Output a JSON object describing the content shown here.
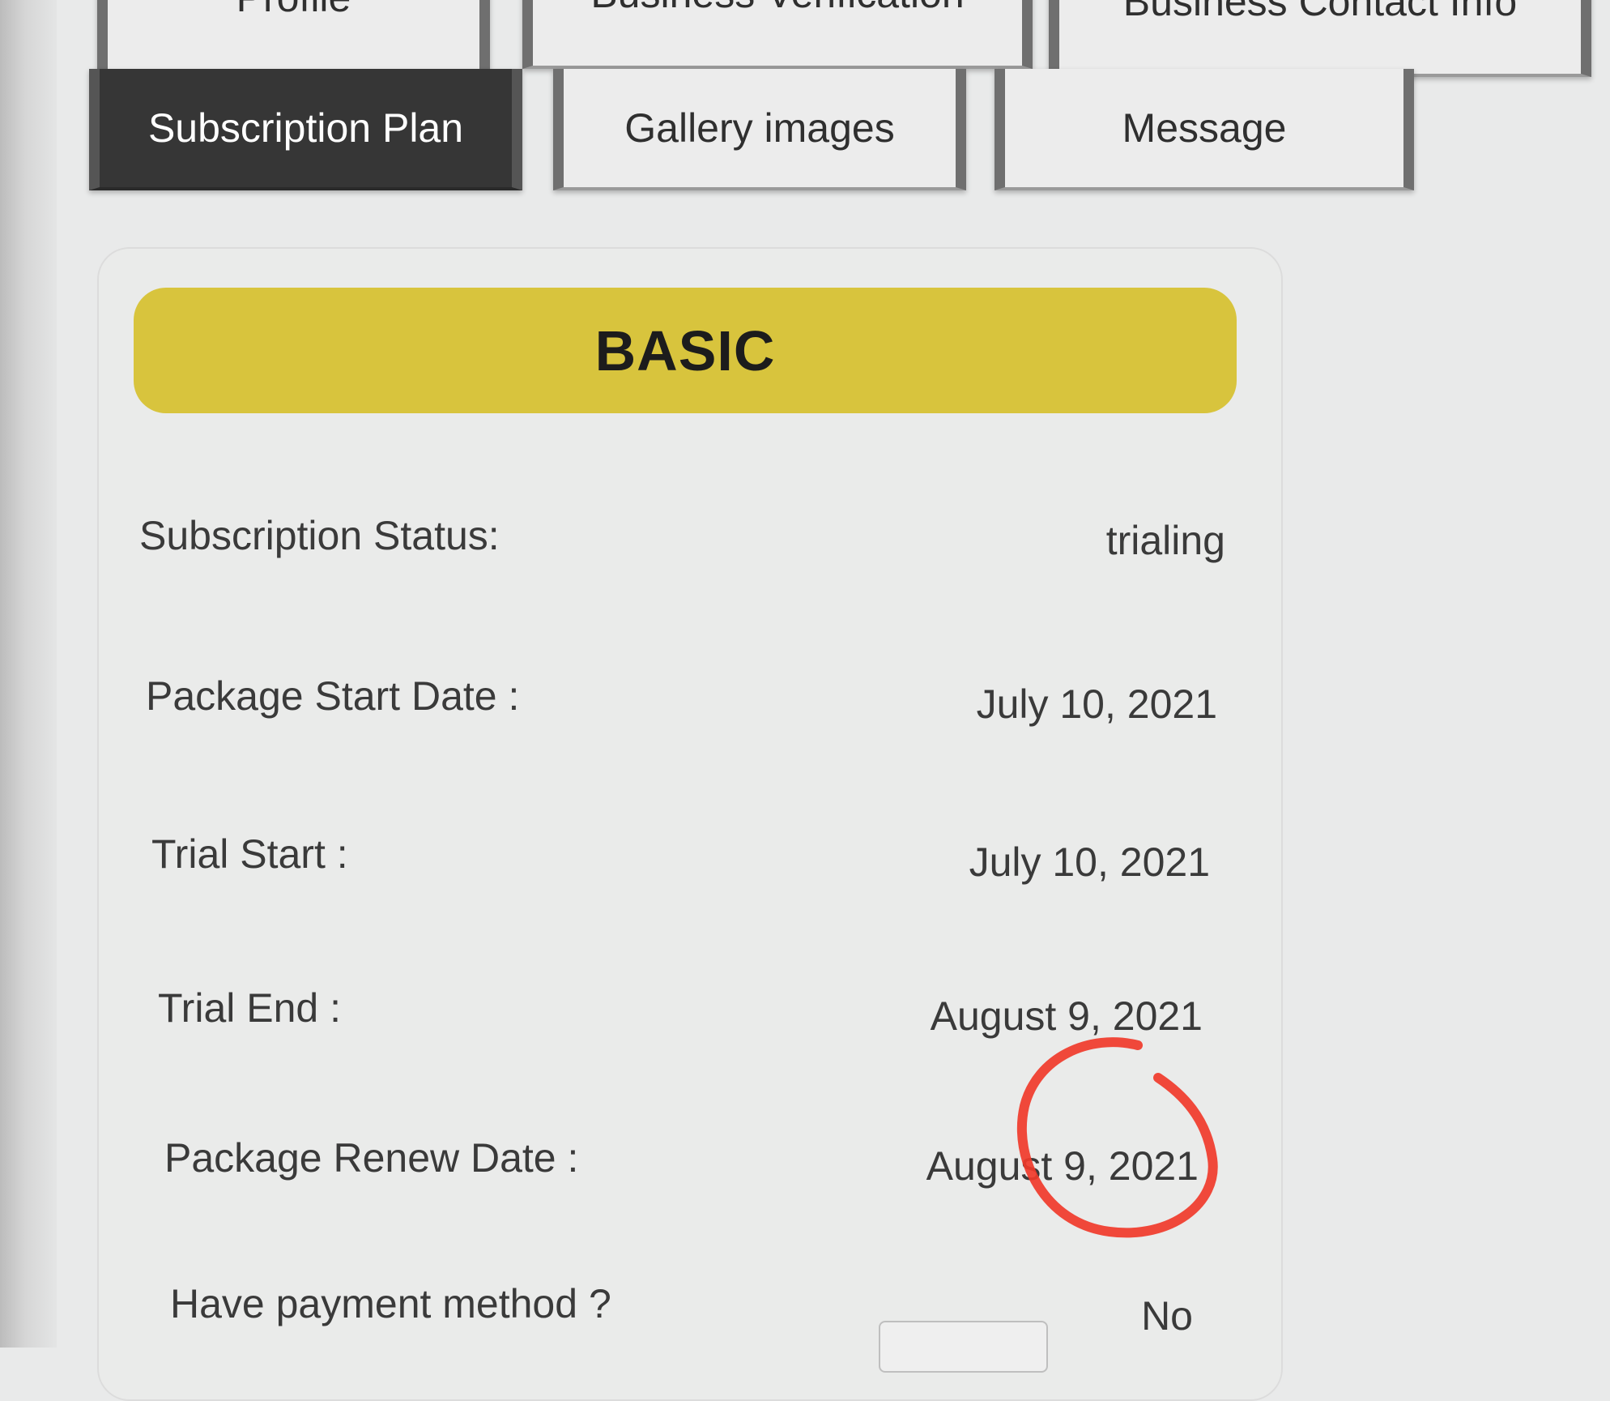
{
  "tabs_row1": [
    {
      "label": "Profile"
    },
    {
      "label": "Business Verification"
    },
    {
      "label": "Business Contact Info"
    }
  ],
  "tabs_row2": [
    {
      "label": "Subscription Plan",
      "active": true
    },
    {
      "label": "Gallery images"
    },
    {
      "label": "Message"
    }
  ],
  "plan": {
    "name": "BASIC",
    "color": "#d8c43d"
  },
  "details": [
    {
      "label": "Subscription Status:",
      "value": "trialing"
    },
    {
      "label": "Package Start Date :",
      "value": "July 10, 2021"
    },
    {
      "label": "Trial Start :",
      "value": "July 10, 2021"
    },
    {
      "label": "Trial End :",
      "value": "August 9, 2021"
    },
    {
      "label": "Package Renew Date :",
      "value": "August 9, 2021"
    },
    {
      "label": "Have payment method ?",
      "value": "No"
    }
  ],
  "annotation": {
    "color": "#f03a2a"
  }
}
